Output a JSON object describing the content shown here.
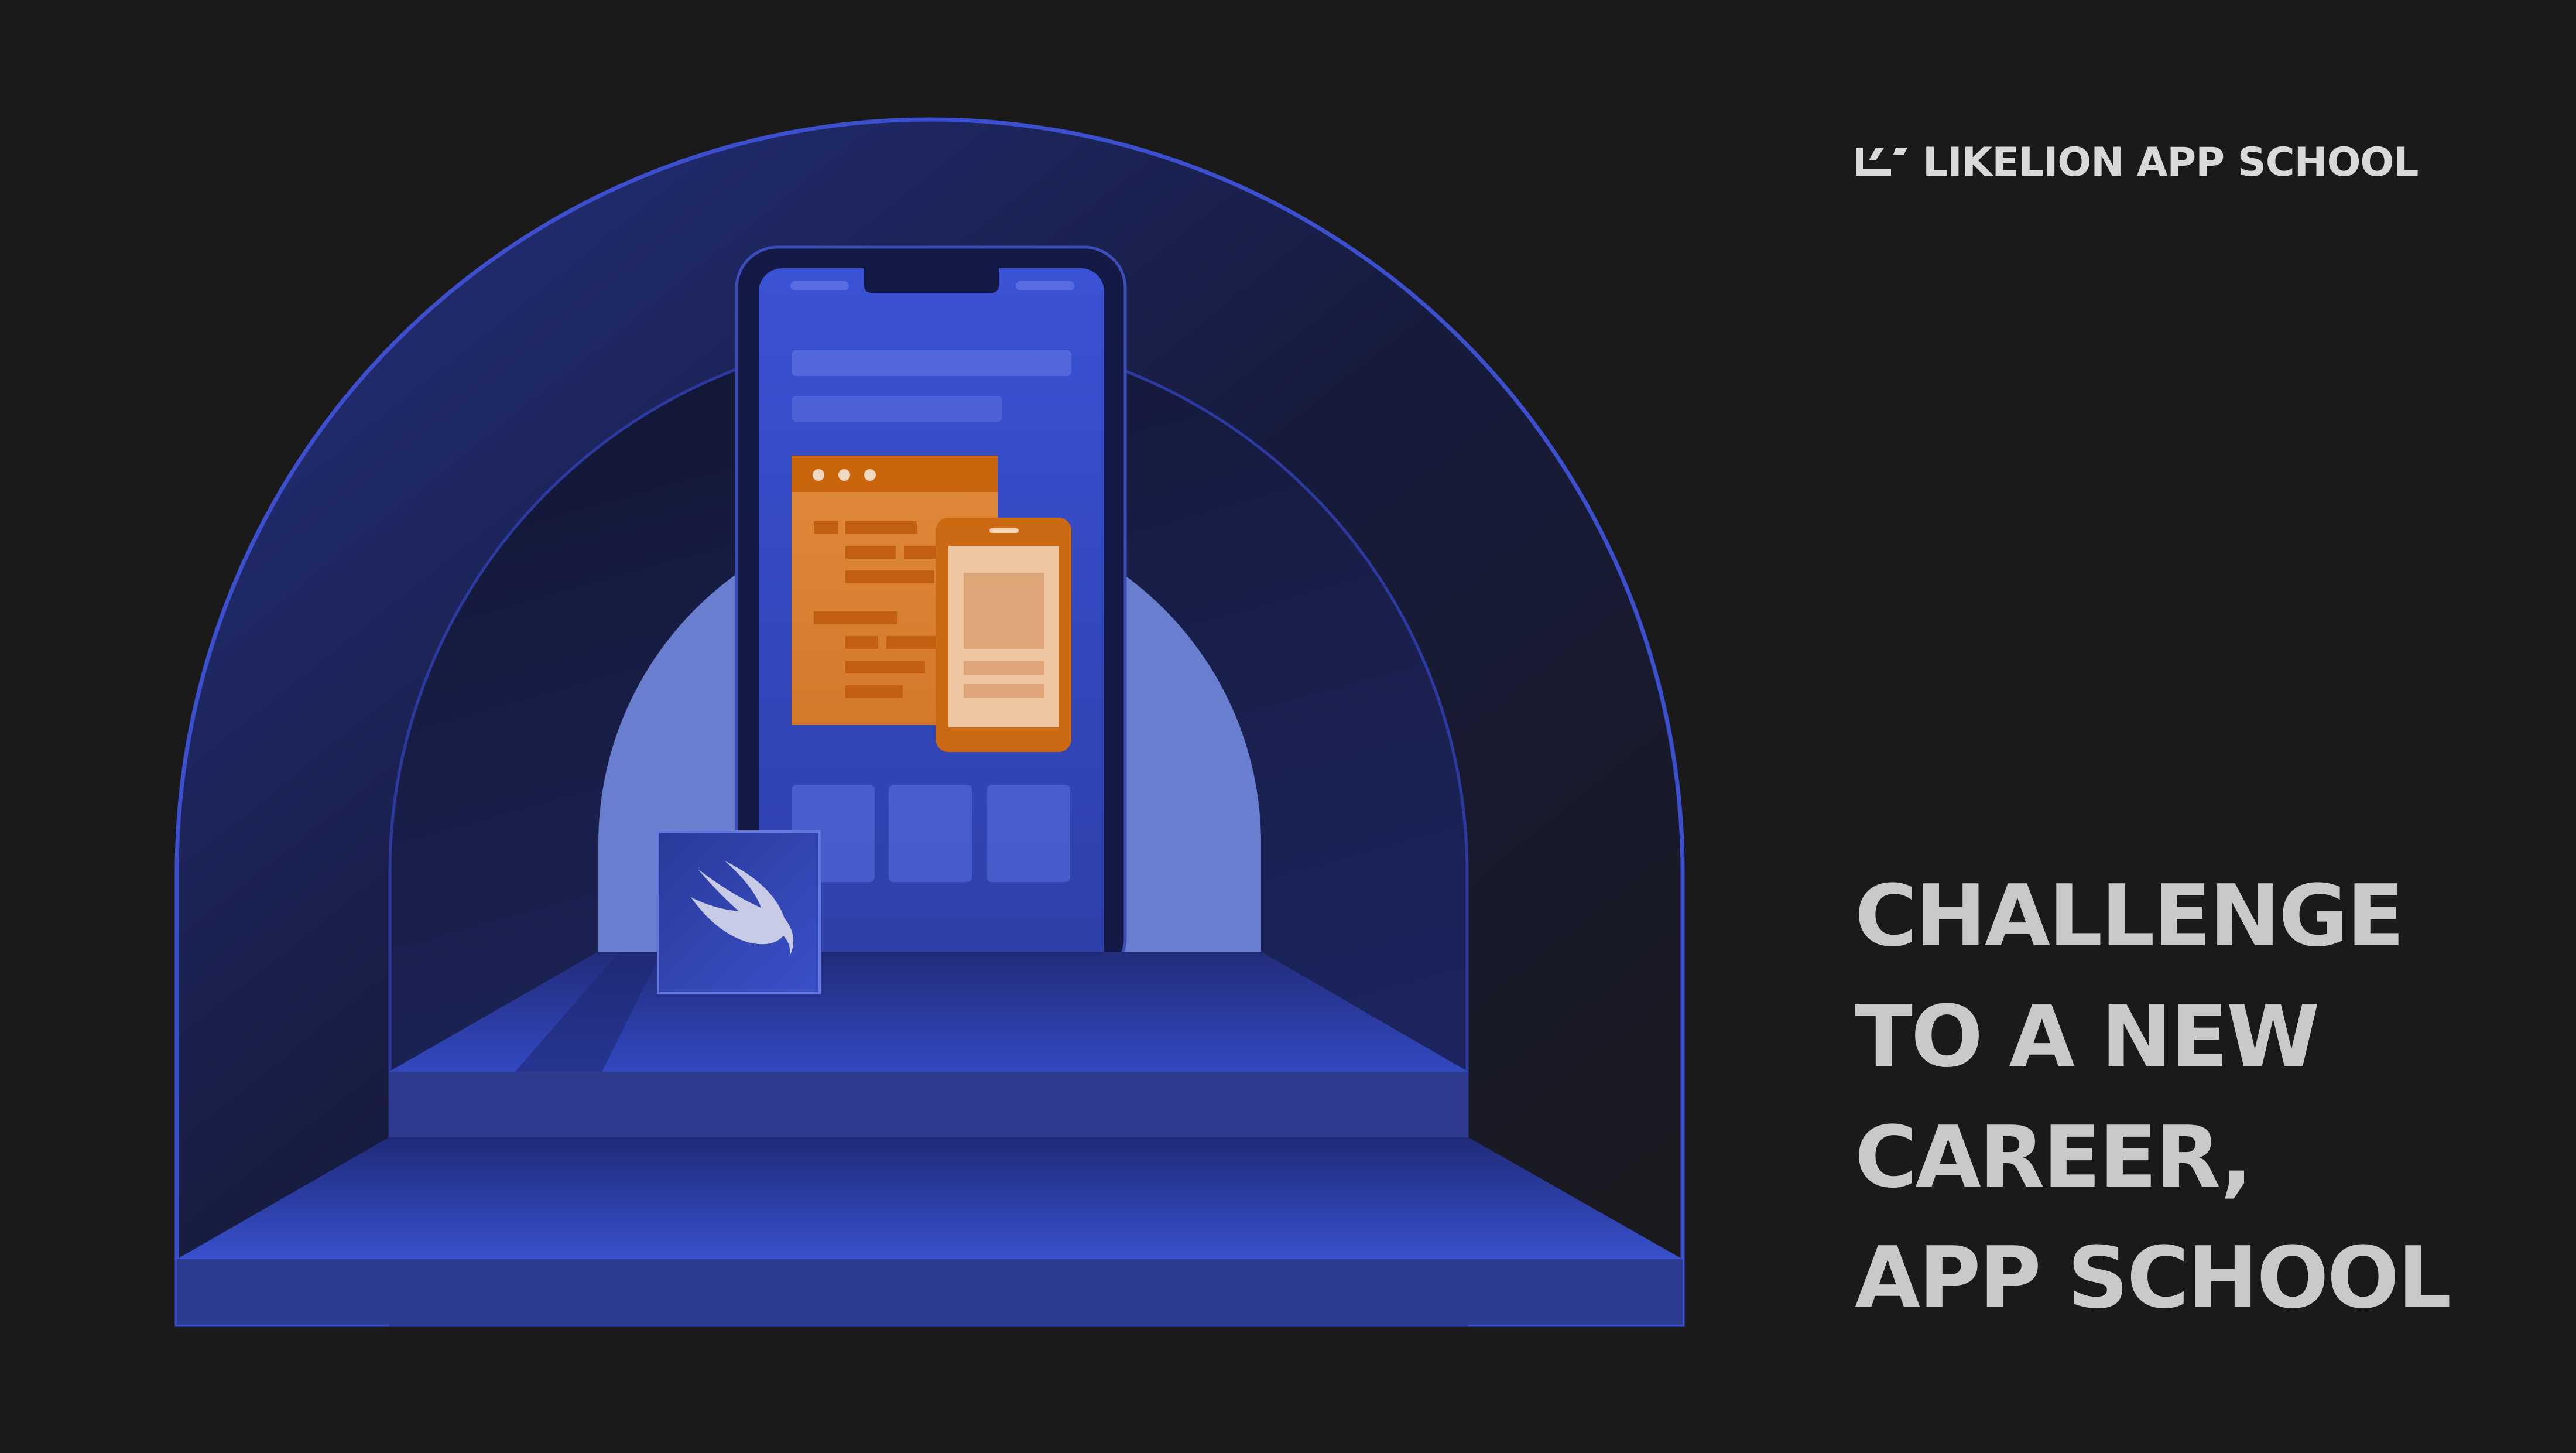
{
  "brand": {
    "text": "LIKELION APP SCHOOL",
    "logo_icon": "likelion-logo-icon"
  },
  "headline": {
    "line1": "CHALLENGE",
    "line2": "TO A NEW",
    "line3": "CAREER,",
    "line4": "APP SCHOOL"
  },
  "illustration": {
    "language_icon": "swift-bird-icon",
    "device": "smartphone"
  },
  "colors": {
    "background": "#1a1a1b",
    "accent_blue": "#3a4fc9",
    "accent_orange": "#d4721a",
    "text": "#c9c9cc"
  }
}
